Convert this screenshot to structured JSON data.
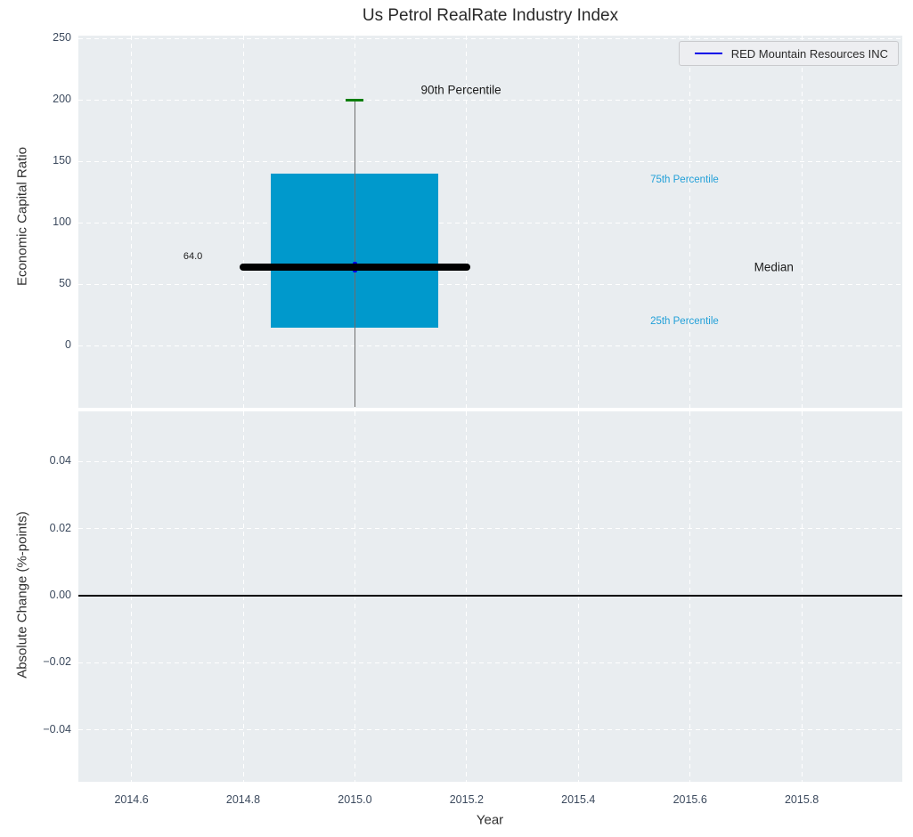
{
  "legend": {
    "label": "RED Mountain Resources INC"
  },
  "colors": {
    "plot_bg": "#e9edf0",
    "grid": "#ffffff",
    "box_fill": "#0099cc",
    "median_line": "#000000",
    "whisker": "#6e6e6e",
    "cap_90th": "#0c7e0c",
    "company_line": "#0000e8",
    "tick_label": "#3c4a5e",
    "annotation_dark": "#1a1a1a",
    "annotation_percentile": "#22a0d8",
    "zero_line": "#000000"
  },
  "chart_data": [
    {
      "type": "boxplot",
      "panel": "top",
      "title": "Us Petrol RealRate Industry Index",
      "ylabel": "Economic Capital Ratio",
      "ylim": [
        -50.5,
        252.2
      ],
      "xlim": [
        2014.505,
        2015.98
      ],
      "grid": true,
      "legend_position": "upper right",
      "yticks": [
        {
          "v": 0,
          "label": "0"
        },
        {
          "v": 50,
          "label": "50"
        },
        {
          "v": 100,
          "label": "100"
        },
        {
          "v": 150,
          "label": "150"
        },
        {
          "v": 200,
          "label": "200"
        },
        {
          "v": 250,
          "label": "250"
        }
      ],
      "xticks": [
        {
          "v": 2014.6,
          "label": "2014.6"
        },
        {
          "v": 2014.8,
          "label": "2014.8"
        },
        {
          "v": 2015.0,
          "label": "2015.0"
        },
        {
          "v": 2015.2,
          "label": "2015.2"
        },
        {
          "v": 2015.4,
          "label": "2015.4"
        },
        {
          "v": 2015.6,
          "label": "2015.6"
        },
        {
          "v": 2015.8,
          "label": "2015.8"
        }
      ],
      "show_xtick_labels": false,
      "box": {
        "x": 2015.0,
        "half_width": 0.15,
        "q1": 15,
        "median": 64.0,
        "q3": 140,
        "p90": 200,
        "whisker_low": -50,
        "cap_half_width": 0.016,
        "median_line_half_width": 0.2
      },
      "series": [
        {
          "name": "RED Mountain Resources INC",
          "x": [
            2015.0
          ],
          "y": [
            64.0
          ]
        }
      ],
      "annotations": [
        {
          "text": "64.0",
          "x": 2014.71,
          "y": 72.5,
          "colorKey": "annotation_dark",
          "size": 11
        },
        {
          "text": "90th Percentile",
          "x": 2015.19,
          "y": 208,
          "colorKey": "annotation_dark",
          "size": 13.5
        },
        {
          "text": "75th Percentile",
          "x": 2015.59,
          "y": 135,
          "colorKey": "annotation_percentile",
          "size": 11.5
        },
        {
          "text": "Median",
          "x": 2015.75,
          "y": 64,
          "colorKey": "annotation_dark",
          "size": 13.5
        },
        {
          "text": "25th Percentile",
          "x": 2015.59,
          "y": 20,
          "colorKey": "annotation_percentile",
          "size": 11.5
        }
      ]
    },
    {
      "type": "line",
      "panel": "bottom",
      "ylabel": "Absolute Change (%-points)",
      "xlabel": "Year",
      "ylim": [
        -0.0555,
        0.0549
      ],
      "xlim": [
        2014.505,
        2015.98
      ],
      "grid": true,
      "zero_line": 0.0,
      "yticks": [
        {
          "v": -0.04,
          "label": "−0.04"
        },
        {
          "v": -0.02,
          "label": "−0.02"
        },
        {
          "v": 0,
          "label": "0.00"
        },
        {
          "v": 0.02,
          "label": "0.02"
        },
        {
          "v": 0.04,
          "label": "0.04"
        }
      ],
      "xticks": [
        {
          "v": 2014.6,
          "label": "2014.6"
        },
        {
          "v": 2014.8,
          "label": "2014.8"
        },
        {
          "v": 2015.0,
          "label": "2015.0"
        },
        {
          "v": 2015.2,
          "label": "2015.2"
        },
        {
          "v": 2015.4,
          "label": "2015.4"
        },
        {
          "v": 2015.6,
          "label": "2015.6"
        },
        {
          "v": 2015.8,
          "label": "2015.8"
        }
      ],
      "show_xtick_labels": true
    }
  ]
}
